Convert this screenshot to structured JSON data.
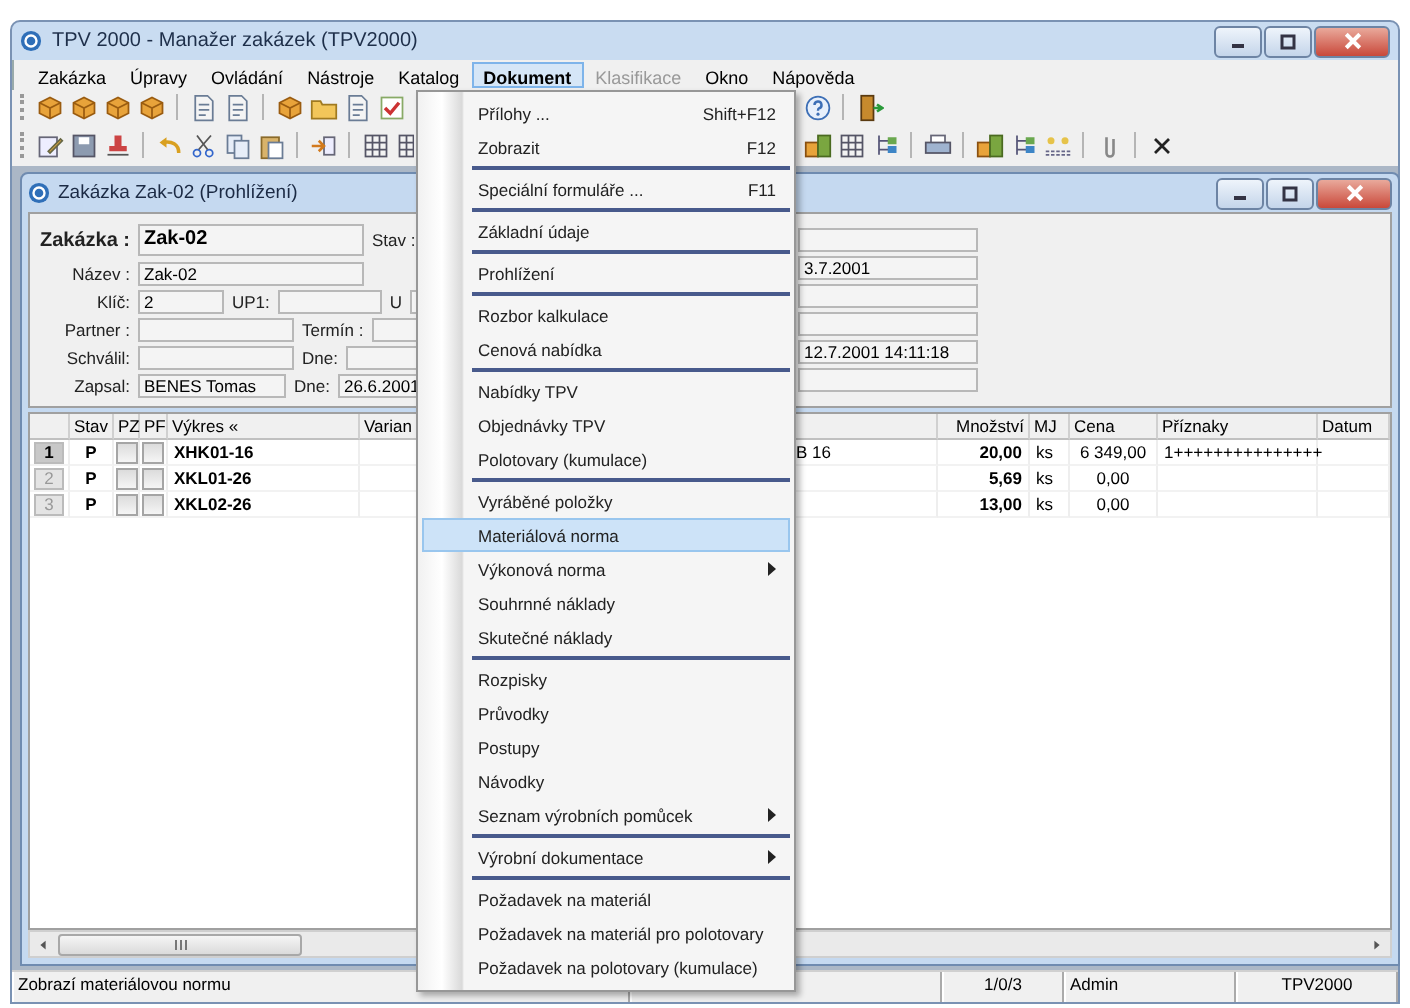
{
  "window": {
    "title": "TPV 2000 - Manažer zakázek (TPV2000)"
  },
  "menu_bar": [
    {
      "label": "Zakázka",
      "selected": false,
      "disabled": false
    },
    {
      "label": "Úpravy",
      "selected": false,
      "disabled": false
    },
    {
      "label": "Ovládání",
      "selected": false,
      "disabled": false
    },
    {
      "label": "Nástroje",
      "selected": false,
      "disabled": false
    },
    {
      "label": "Katalog",
      "selected": false,
      "disabled": false
    },
    {
      "label": "Dokument",
      "selected": true,
      "disabled": false
    },
    {
      "label": "Klasifikace",
      "selected": false,
      "disabled": true
    },
    {
      "label": "Okno",
      "selected": false,
      "disabled": false
    },
    {
      "label": "Nápověda",
      "selected": false,
      "disabled": false
    }
  ],
  "child_window": {
    "title": "Zakázka Zak-02 (Prohlížení)"
  },
  "form": {
    "rows": [
      {
        "fields": [
          {
            "label": "Zakázka :",
            "value": "Zak-02"
          },
          {
            "label": "Stav :"
          }
        ]
      },
      {
        "fields": [
          {
            "label": "Název :",
            "value": "Zak-02"
          }
        ],
        "right_value": "3.7.2001"
      },
      {
        "fields": [
          {
            "label": "Klíč:",
            "value": "2"
          },
          {
            "label": "UP1:"
          },
          {
            "label": "U"
          }
        ]
      },
      {
        "fields": [
          {
            "label": "Partner :"
          },
          {
            "label": "Termín :"
          }
        ]
      },
      {
        "fields": [
          {
            "label": "Schválil:"
          },
          {
            "label": "Dne:"
          }
        ],
        "right_value": "12.7.2001 14:11:18"
      },
      {
        "fields": [
          {
            "label": "Zapsal:",
            "value": "BENES Tomas"
          },
          {
            "label": "Dne:",
            "value": "26.6.2001"
          }
        ]
      }
    ]
  },
  "table": {
    "columns": [
      "Stav",
      "PZ",
      "PF",
      "Výkres «",
      "Varian",
      "Množství",
      "MJ",
      "Cena",
      "Příznaky",
      "Datum"
    ],
    "rows": [
      {
        "number": "1",
        "selected": true,
        "stav": "P",
        "pz": false,
        "pf": false,
        "vykres": "XHK01-16",
        "column_7": "B 16",
        "mnozstvi": "20,00",
        "mj": "ks",
        "cena": "6 349,00",
        "priznaky": "1+++++++++++++++"
      },
      {
        "number": "2",
        "selected": false,
        "stav": "P",
        "pz": false,
        "pf": false,
        "vykres": "XKL01-26",
        "mnozstvi": "5,69",
        "mj": "ks",
        "cena": "0,00"
      },
      {
        "number": "3",
        "selected": false,
        "stav": "P",
        "pz": false,
        "pf": false,
        "vykres": "XKL02-26",
        "mnozstvi": "13,00",
        "mj": "ks",
        "cena": "0,00"
      }
    ]
  },
  "dropdown_menu": {
    "groups": [
      [
        {
          "label": "Přílohy ...",
          "shortcut": "Shift+F12",
          "submenu": false,
          "selected": false
        },
        {
          "label": "Zobrazit",
          "shortcut": "F12",
          "submenu": false,
          "selected": false
        }
      ],
      [
        {
          "label": "Speciální formuláře ...",
          "shortcut": "F11",
          "submenu": false,
          "selected": false
        }
      ],
      [
        {
          "label": "Základní údaje",
          "submenu": false,
          "selected": false
        }
      ],
      [
        {
          "label": "Prohlížení",
          "submenu": false,
          "selected": false
        }
      ],
      [
        {
          "label": "Rozbor kalkulace",
          "submenu": false,
          "selected": false
        },
        {
          "label": "Cenová nabídka",
          "submenu": false,
          "selected": false
        }
      ],
      [
        {
          "label": "Nabídky TPV",
          "submenu": false,
          "selected": false
        },
        {
          "label": "Objednávky TPV",
          "submenu": false,
          "selected": false
        },
        {
          "label": "Polotovary (kumulace)",
          "submenu": false,
          "selected": false
        }
      ],
      [
        {
          "label": "Vyráběné položky",
          "submenu": false,
          "selected": false
        },
        {
          "label": "Materiálová norma",
          "submenu": false,
          "selected": true
        },
        {
          "label": "Výkonová norma",
          "submenu": true,
          "selected": false
        },
        {
          "label": "Souhrnné náklady",
          "submenu": false,
          "selected": false
        },
        {
          "label": "Skutečné náklady",
          "submenu": false,
          "selected": false
        }
      ],
      [
        {
          "label": "Rozpisky",
          "submenu": false,
          "selected": false
        },
        {
          "label": "Průvodky",
          "submenu": false,
          "selected": false
        },
        {
          "label": "Postupy",
          "submenu": false,
          "selected": false
        },
        {
          "label": "Návodky",
          "submenu": false,
          "selected": false
        },
        {
          "label": "Seznam výrobních pomůcek",
          "submenu": true,
          "selected": false
        }
      ],
      [
        {
          "label": "Výrobní dokumentace",
          "submenu": true,
          "selected": false
        }
      ],
      [
        {
          "label": "Požadavek na materiál",
          "submenu": false,
          "selected": false
        },
        {
          "label": "Požadavek na materiál pro polotovary",
          "submenu": false,
          "selected": false
        },
        {
          "label": "Požadavek na polotovary (kumulace)",
          "submenu": false,
          "selected": false
        }
      ]
    ]
  },
  "status_bar": {
    "message": "Zobrazí materiálovou normu",
    "counter": "1/0/3",
    "user": "Admin",
    "app": "TPV2000"
  }
}
